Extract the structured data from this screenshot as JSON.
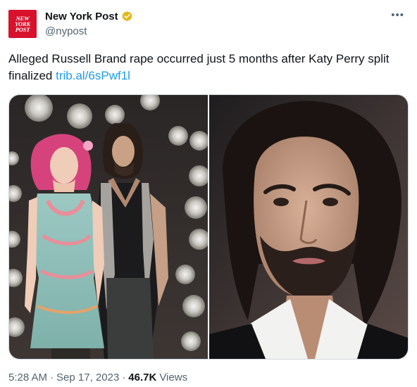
{
  "account": {
    "display_name": "New York Post",
    "handle": "@nypost",
    "avatar_text": [
      "NEW",
      "YORK",
      "POST"
    ]
  },
  "tweet": {
    "text": "Alleged Russell Brand rape occurred just 5 months after Katy Perry split finalized",
    "link_text": "trib.al/6sPwf1l"
  },
  "media": {
    "images": [
      {
        "name": "photo-katy-perry-russell-brand"
      },
      {
        "name": "photo-russell-brand-closeup"
      }
    ]
  },
  "meta": {
    "time": "5:28 AM",
    "date": "Sep 17, 2023",
    "views_count": "46.7K",
    "views_label": "Views"
  },
  "colors": {
    "link": "#1d9bf0",
    "verified_badge": "#e2b719",
    "secondary_text": "#536471",
    "nypost_red": "#d8112c"
  },
  "icons": {
    "verified": "verified-badge-icon",
    "more": "more-options-icon"
  }
}
